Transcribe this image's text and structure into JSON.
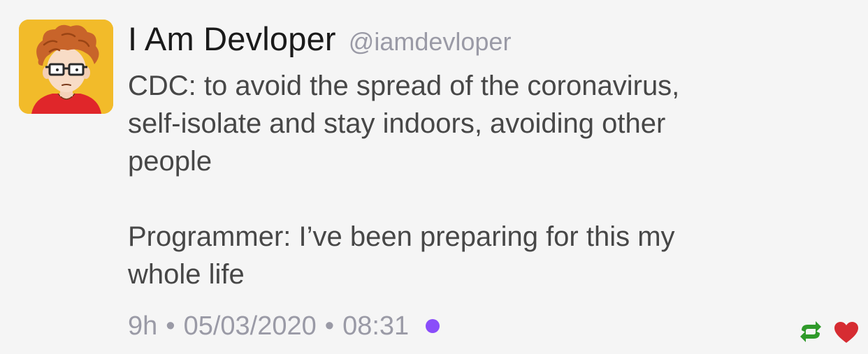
{
  "author": {
    "display_name": "I Am Devloper",
    "handle": "@iamdevloper",
    "avatar_icon": "cartoon-programmer-avatar"
  },
  "tweet": {
    "paragraphs": [
      "CDC: to avoid the spread of the coronavirus,\nself-isolate and stay indoors, avoiding other\npeople",
      "Programmer: I’ve been preparing for this my\nwhole life"
    ]
  },
  "meta": {
    "relative_time": "9h",
    "separator": "•",
    "date": "05/03/2020",
    "time": "08:31"
  },
  "actions": {
    "retweet_icon": "retweet-icon",
    "like_icon": "heart-icon"
  },
  "colors": {
    "background": "#f5f5f5",
    "avatar_background": "#f2bb2a",
    "status_dot": "#8a4dfa",
    "retweet": "#2f9a2a",
    "like": "#d62c32"
  }
}
